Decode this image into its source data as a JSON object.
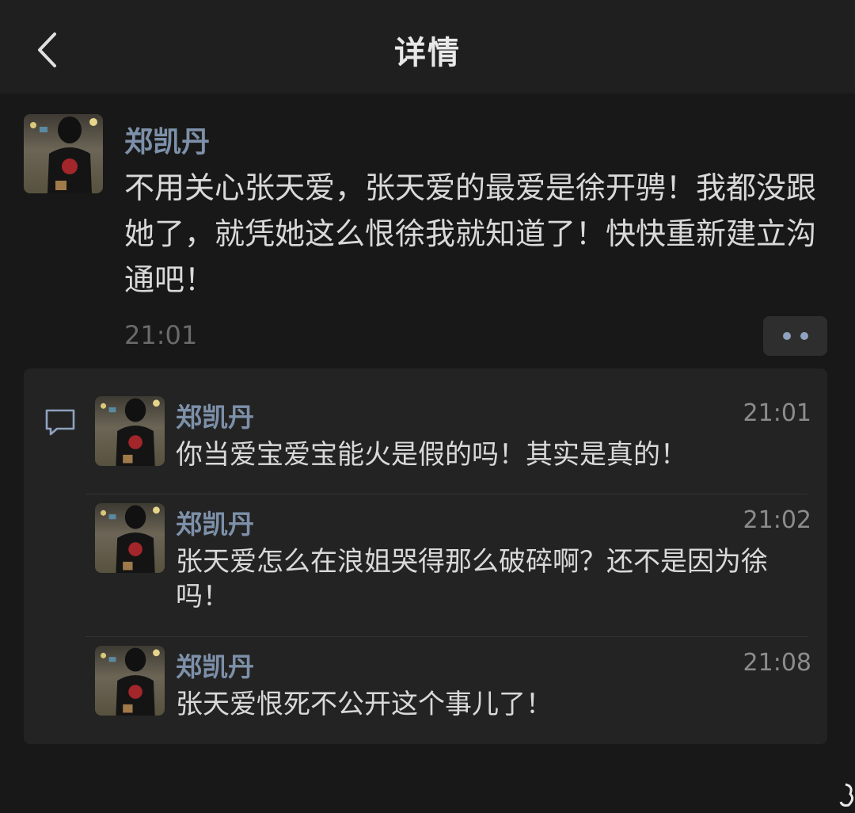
{
  "navbar": {
    "title": "详情"
  },
  "post": {
    "author": "郑凯丹",
    "text": "不用关心张天爱，张天爱的最爱是徐开骋！我都没跟她了，就凭她这么恨徐我就知道了！快快重新建立沟通吧！",
    "time": "21:01"
  },
  "comments": [
    {
      "author": "郑凯丹",
      "time": "21:01",
      "text": "你当爱宝爱宝能火是假的吗！其实是真的！"
    },
    {
      "author": "郑凯丹",
      "time": "21:02",
      "text": "张天爱怎么在浪姐哭得那么破碎啊？还不是因为徐吗！"
    },
    {
      "author": "郑凯丹",
      "time": "21:08",
      "text": "张天爱恨死不公开这个事儿了！"
    }
  ],
  "icons": {
    "back": "chevron-left-icon",
    "more": "more-dots-icon",
    "comment": "comment-bubble-icon"
  },
  "colors": {
    "background": "#181818",
    "navbar": "#1f1f1f",
    "comments_panel": "#232323",
    "name": "#7d90a9",
    "text": "#d9d9d9",
    "time": "#6a6a6a"
  }
}
